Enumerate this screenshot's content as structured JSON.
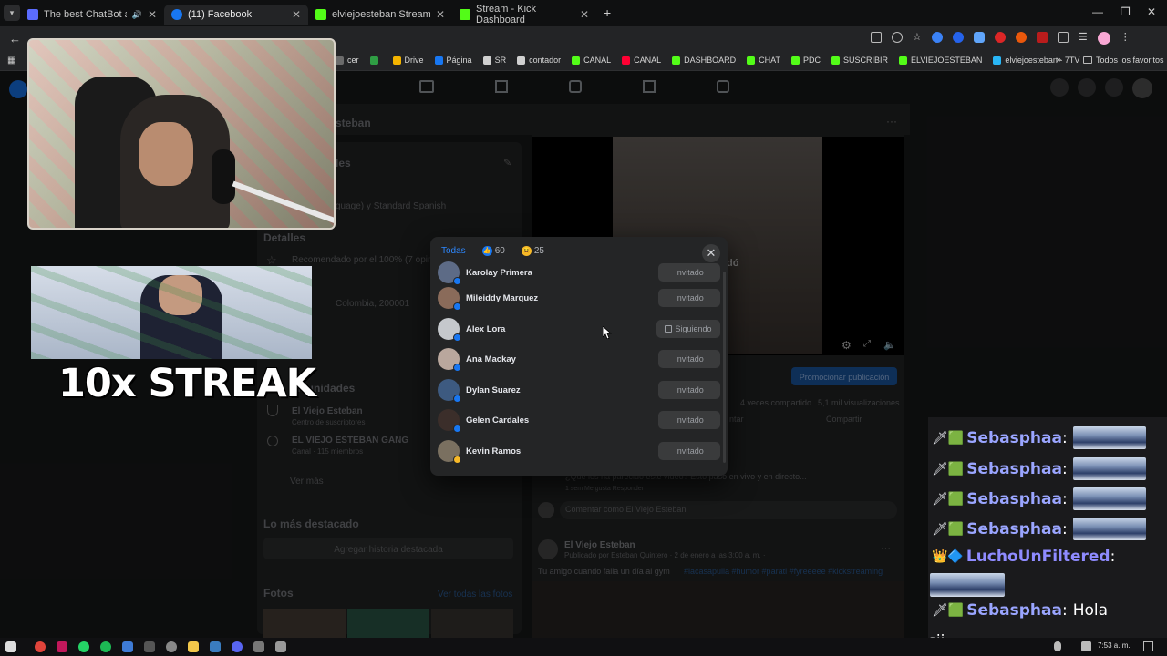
{
  "browser": {
    "tabs": [
      {
        "title": "The best ChatBot and Widg",
        "active": false,
        "audio": true
      },
      {
        "title": "(11) Facebook",
        "active": true,
        "audio": false
      },
      {
        "title": "elviejoesteban Stream - Watch",
        "active": false,
        "audio": false
      },
      {
        "title": "Stream - Kick Dashboard",
        "active": false,
        "audio": false
      }
    ],
    "new_tab": "+",
    "bookmarks": [
      {
        "label": "cer",
        "color": "#6b6b6b"
      },
      {
        "label": "",
        "color": "#2f9e44"
      },
      {
        "label": "Drive",
        "color": "#f4b400"
      },
      {
        "label": "Página",
        "color": "#1877f2"
      },
      {
        "label": "SR",
        "color": "#d0d0d0"
      },
      {
        "label": "contador",
        "color": "#d0d0d0"
      },
      {
        "label": "CANAL",
        "color": "#53fc18"
      },
      {
        "label": "CANAL",
        "color": "#ff0033"
      },
      {
        "label": "DASHBOARD",
        "color": "#53fc18"
      },
      {
        "label": "CHAT",
        "color": "#53fc18"
      },
      {
        "label": "PDC",
        "color": "#53fc18"
      },
      {
        "label": "SUSCRIBIR",
        "color": "#53fc18"
      },
      {
        "label": "ELVIEJOESTEBAN",
        "color": "#53fc18"
      },
      {
        "label": "elviejoesteban - 7TV",
        "color": "#29b6f6"
      }
    ],
    "all_favorites": "Todos los favoritos"
  },
  "facebook": {
    "page_name": "steban",
    "details_heading": "les",
    "language_text": "guage) y Standard Spanish",
    "detalles": "Detalles",
    "recomendado": "Recomendado por el 100% (7 opinio",
    "location": "Colombia, 200001",
    "comunidades": "munidades",
    "comm1_title": "El Viejo Esteban",
    "comm1_sub": "Centro de suscriptores",
    "comm2_title": "EL VIEJO ESTEBAN GANG",
    "comm2_sub": "Canal · 115 miembros",
    "ver_mas": "Ver más",
    "destacado": "Lo más destacado",
    "agregar_historia": "Agregar historia destacada",
    "fotos": "Fotos",
    "ver_fotos": "Ver todas las fotos",
    "video_caption": "dó",
    "promote_button": "Promocionar publicación",
    "shares": "4 veces compartido",
    "views": "5,1 mil visualizaciones",
    "comentar": "ntar",
    "compartir": "Compartir",
    "comment_text": "¿Qué les ha parecido este video? Esto pasó en vivo y en directo...",
    "comment_actions": "1 sem    Me gusta    Responder",
    "comment_placeholder": "Comentar como El Viejo Esteban",
    "post_author": "El Viejo Esteban",
    "post_meta": "Publicado por Esteban Quintero · 2 de enero a las 3:00 a. m. ·",
    "post_text": "Tu amigo cuando falla un día al gym",
    "post_tags": "#lacasapulla #humor #parati #fyreeeee #kickstreaming"
  },
  "reactions_modal": {
    "tab_all": "Todas",
    "tab_like_count": "60",
    "tab_haha_count": "25",
    "close_glyph": "✕",
    "people": [
      {
        "name": "Karolay Primera",
        "button": "Invitado",
        "avatar": "#5d6b86",
        "badge": "#1877f2"
      },
      {
        "name": "Mileiddy Marquez",
        "button": "Invitado",
        "avatar": "#8a6b5a",
        "badge": "#1877f2"
      },
      {
        "name": "Alex Lora",
        "button": "Siguiendo",
        "avatar": "#c5c8cc",
        "badge": "#1877f2"
      },
      {
        "name": "Ana Mackay",
        "button": "Invitado",
        "avatar": "#b9a79d",
        "badge": "#1877f2"
      },
      {
        "name": "Dylan Suarez",
        "button": "Invitado",
        "avatar": "#3d5a80",
        "badge": "#1877f2"
      },
      {
        "name": "Gelen Cardales",
        "button": "Invitado",
        "avatar": "#3b2e2a",
        "badge": "#1877f2"
      },
      {
        "name": "Kevin Ramos",
        "button": "Invitado",
        "avatar": "#7a7060",
        "badge": "#f7b928"
      }
    ]
  },
  "overlay": {
    "streak_text": "10x STREAK"
  },
  "chat": {
    "messages": [
      {
        "user": "Sebasphaa",
        "text": "",
        "emote": true
      },
      {
        "user": "Sebasphaa",
        "text": "",
        "emote": true
      },
      {
        "user": "Sebasphaa",
        "text": "",
        "emote": true
      },
      {
        "user": "Sebasphaa",
        "text": "",
        "emote": true
      },
      {
        "user": "LuchoUnFiltered",
        "text": "",
        "emote": true
      },
      {
        "user": "Sebasphaa",
        "text": "Hola",
        "emote": false
      }
    ],
    "overflow_text": "sii"
  },
  "taskbar": {
    "time": "7:53 a. m."
  }
}
